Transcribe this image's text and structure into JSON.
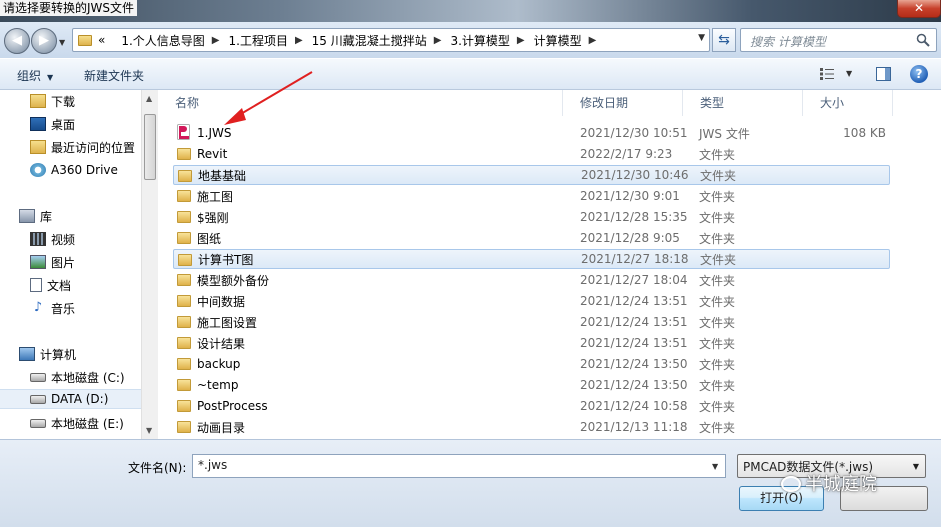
{
  "window": {
    "title": "请选择要转换的JWS文件",
    "close_label": "✕"
  },
  "address": {
    "prefix": "«",
    "crumbs": [
      "1.个人信息导图",
      "1.工程项目",
      "15 川藏混凝土搅拌站",
      "3.计算模型",
      "计算模型"
    ]
  },
  "search": {
    "placeholder": "搜索 计算模型"
  },
  "toolbar": {
    "organize": "组织",
    "new_folder": "新建文件夹"
  },
  "nav": [
    {
      "label": "下载",
      "icon": "download-folder-icon"
    },
    {
      "label": "桌面",
      "icon": "desktop-icon"
    },
    {
      "label": "最近访问的位置",
      "icon": "recent-places-icon"
    },
    {
      "label": "A360 Drive",
      "icon": "a360-drive-icon"
    },
    {
      "label": "库",
      "icon": "library-icon"
    },
    {
      "label": "视频",
      "icon": "video-icon"
    },
    {
      "label": "图片",
      "icon": "pictures-icon"
    },
    {
      "label": "文档",
      "icon": "documents-icon"
    },
    {
      "label": "音乐",
      "icon": "music-icon"
    },
    {
      "label": "计算机",
      "icon": "computer-icon"
    },
    {
      "label": "本地磁盘 (C:)",
      "icon": "drive-icon"
    },
    {
      "label": "DATA (D:)",
      "icon": "drive-icon"
    },
    {
      "label": "本地磁盘 (E:)",
      "icon": "drive-icon"
    }
  ],
  "columns": {
    "name": "名称",
    "date": "修改日期",
    "type": "类型",
    "size": "大小"
  },
  "files": [
    {
      "name": "1.JWS",
      "date": "2021/12/30 10:51",
      "type": "JWS 文件",
      "size": "108 KB"
    },
    {
      "name": "Revit",
      "date": "2022/2/17 9:23",
      "type": "文件夹",
      "size": ""
    },
    {
      "name": "地基基础",
      "date": "2021/12/30 10:46",
      "type": "文件夹",
      "size": ""
    },
    {
      "name": "施工图",
      "date": "2021/12/30 9:01",
      "type": "文件夹",
      "size": ""
    },
    {
      "name": "$强刚",
      "date": "2021/12/28 15:35",
      "type": "文件夹",
      "size": ""
    },
    {
      "name": "图纸",
      "date": "2021/12/28 9:05",
      "type": "文件夹",
      "size": ""
    },
    {
      "name": "计算书T图",
      "date": "2021/12/27 18:18",
      "type": "文件夹",
      "size": ""
    },
    {
      "name": "模型额外备份",
      "date": "2021/12/27 18:04",
      "type": "文件夹",
      "size": ""
    },
    {
      "name": "中间数据",
      "date": "2021/12/24 13:51",
      "type": "文件夹",
      "size": ""
    },
    {
      "name": "施工图设置",
      "date": "2021/12/24 13:51",
      "type": "文件夹",
      "size": ""
    },
    {
      "name": "设计结果",
      "date": "2021/12/24 13:51",
      "type": "文件夹",
      "size": ""
    },
    {
      "name": "backup",
      "date": "2021/12/24 13:50",
      "type": "文件夹",
      "size": ""
    },
    {
      "name": "~temp",
      "date": "2021/12/24 13:50",
      "type": "文件夹",
      "size": ""
    },
    {
      "name": "PostProcess",
      "date": "2021/12/24 10:58",
      "type": "文件夹",
      "size": ""
    },
    {
      "name": "动画目录",
      "date": "2021/12/13 11:18",
      "type": "文件夹",
      "size": ""
    }
  ],
  "bottom": {
    "filename_label": "文件名(N):",
    "filename_value": "*.jws",
    "filetype": "PMCAD数据文件(*.jws)",
    "open_label": "打开(O)"
  },
  "watermark": "半城庭院"
}
